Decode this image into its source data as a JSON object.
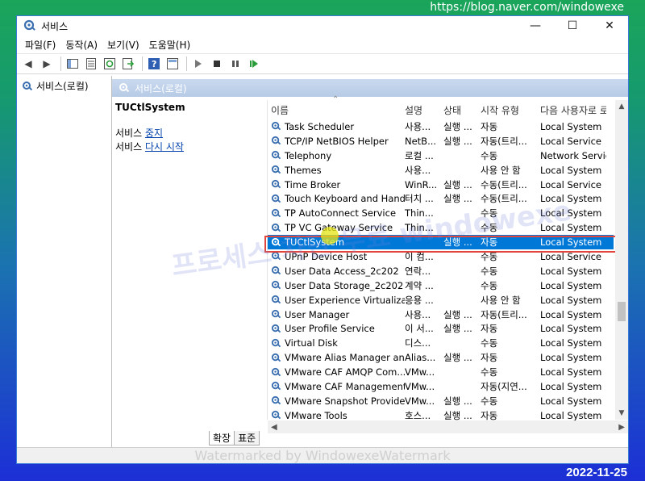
{
  "overlay": {
    "url": "https://blog.naver.com/windowexe",
    "date": "2022-11-25"
  },
  "window": {
    "title": "서비스",
    "controls": [
      "—",
      "☐",
      "✕"
    ]
  },
  "menu": [
    {
      "label": "파일(F)"
    },
    {
      "label": "동작(A)"
    },
    {
      "label": "보기(V)"
    },
    {
      "label": "도움말(H)"
    }
  ],
  "toolbar": [
    "back-icon",
    "forward-icon",
    "console-tree-icon",
    "properties-icon",
    "refresh-icon",
    "export-icon",
    "help-icon",
    "view-icon",
    "play-icon",
    "stop-icon",
    "pause-icon",
    "resume-icon"
  ],
  "tree": {
    "root_label": "서비스(로컬)"
  },
  "content": {
    "header_label": "서비스(로컬)",
    "detail": {
      "service_name": "TUCtlSystem",
      "stop_prefix": "서비스 ",
      "stop_link": "중지",
      "restart_prefix": "서비스 ",
      "restart_link": "다시 시작"
    },
    "columns": {
      "name": "이름",
      "desc": "설명",
      "status": "상태",
      "startup": "시작 유형",
      "logon": "다음 사용자로 로"
    },
    "rows": [
      {
        "name": "Task Scheduler",
        "desc": "사용...",
        "status": "실행 ...",
        "startup": "자동",
        "logon": "Local System"
      },
      {
        "name": "TCP/IP NetBIOS Helper",
        "desc": "NetB...",
        "status": "실행 ...",
        "startup": "자동(트리...",
        "logon": "Local Service"
      },
      {
        "name": "Telephony",
        "desc": "로컬 ...",
        "status": "",
        "startup": "수동",
        "logon": "Network Service"
      },
      {
        "name": "Themes",
        "desc": "사용...",
        "status": "",
        "startup": "사용 안 함",
        "logon": "Local System"
      },
      {
        "name": "Time Broker",
        "desc": "WinR...",
        "status": "실행 ...",
        "startup": "수동(트리...",
        "logon": "Local Service"
      },
      {
        "name": "Touch Keyboard and Hand...",
        "desc": "터치 ...",
        "status": "실행 ...",
        "startup": "수동(트리...",
        "logon": "Local System"
      },
      {
        "name": "TP AutoConnect Service",
        "desc": "Thin...",
        "status": "",
        "startup": "수동",
        "logon": "Local System"
      },
      {
        "name": "TP VC Gateway Service",
        "desc": "Thin...",
        "status": "",
        "startup": "수동",
        "logon": "Local System"
      },
      {
        "name": "TUCtlSystem",
        "desc": "",
        "status": "실행 ...",
        "startup": "자동",
        "logon": "Local System",
        "selected": true
      },
      {
        "name": "UPnP Device Host",
        "desc": "이 컴...",
        "status": "",
        "startup": "수동",
        "logon": "Local Service"
      },
      {
        "name": "User Data Access_2c202",
        "desc": "연락...",
        "status": "",
        "startup": "수동",
        "logon": "Local System"
      },
      {
        "name": "User Data Storage_2c202",
        "desc": "계약 ...",
        "status": "",
        "startup": "수동",
        "logon": "Local System"
      },
      {
        "name": "User Experience Virtualizati...",
        "desc": "응용 ...",
        "status": "",
        "startup": "사용 안 함",
        "logon": "Local System"
      },
      {
        "name": "User Manager",
        "desc": "사용...",
        "status": "실행 ...",
        "startup": "자동(트리...",
        "logon": "Local System"
      },
      {
        "name": "User Profile Service",
        "desc": "이 서...",
        "status": "실행 ...",
        "startup": "자동",
        "logon": "Local System"
      },
      {
        "name": "Virtual Disk",
        "desc": "디스...",
        "status": "",
        "startup": "수동",
        "logon": "Local System"
      },
      {
        "name": "VMware Alias Manager an...",
        "desc": "Alias...",
        "status": "실행 ...",
        "startup": "자동",
        "logon": "Local System"
      },
      {
        "name": "VMware CAF AMQP Com...",
        "desc": "VMw...",
        "status": "",
        "startup": "수동",
        "logon": "Local System"
      },
      {
        "name": "VMware CAF Management...",
        "desc": "VMw...",
        "status": "",
        "startup": "자동(지연...",
        "logon": "Local System"
      },
      {
        "name": "VMware Snapshot Provider",
        "desc": "VMw...",
        "status": "실행 ...",
        "startup": "수동",
        "logon": "Local System"
      },
      {
        "name": "VMware Tools",
        "desc": "호스...",
        "status": "실행 ...",
        "startup": "자동",
        "logon": "Local System"
      }
    ]
  },
  "tabs": [
    {
      "label": "확장"
    },
    {
      "label": "표준"
    }
  ],
  "statusbar": {
    "watermark": "Watermarked by WindowexeWatermark"
  },
  "background_watermark": "프로세스 차단 무료 windowexe",
  "colors": {
    "selection": "#0078d7",
    "highlight_border": "#e2453c",
    "link": "#0645ad"
  }
}
